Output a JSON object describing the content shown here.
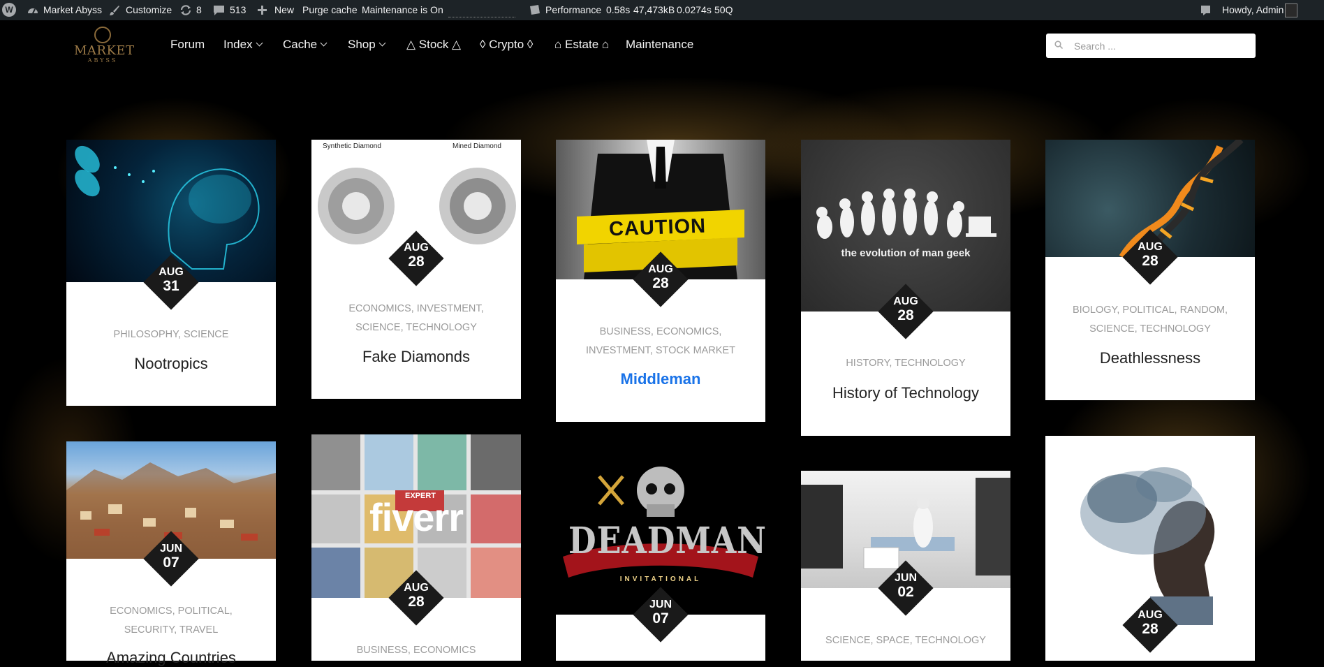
{
  "admin_bar": {
    "site_name": "Market Abyss",
    "customize": "Customize",
    "updates": "8",
    "comments": "513",
    "new": "New",
    "purge_cache": "Purge cache",
    "maintenance": "Maintenance is On",
    "performance": "Performance",
    "perf_time": "0.58s",
    "perf_memory": "47,473kB",
    "perf_db_time": "0.0274s",
    "perf_queries": "50Q",
    "greeting": "Howdy, Admin"
  },
  "logo": {
    "text": "MARKET",
    "subtext": "ABYSS"
  },
  "nav": [
    {
      "label": "Forum",
      "dropdown": false
    },
    {
      "label": "Index",
      "dropdown": true
    },
    {
      "label": "Cache",
      "dropdown": true
    },
    {
      "label": "Shop",
      "dropdown": true
    },
    {
      "label": "△ Stock △",
      "dropdown": false
    },
    {
      "label": "◊ Crypto ◊",
      "dropdown": false
    },
    {
      "label": "⌂ Estate ⌂",
      "dropdown": false
    },
    {
      "label": "Maintenance",
      "dropdown": false
    }
  ],
  "search": {
    "placeholder": "Search ..."
  },
  "posts": [
    {
      "month": "AUG",
      "day": "31",
      "cats_line1": "PHILOSOPHY, SCIENCE",
      "cats_line2": "",
      "title": "Nootropics"
    },
    {
      "month": "AUG",
      "day": "28",
      "cats_line1": "ECONOMICS, INVESTMENT,",
      "cats_line2": "SCIENCE, TECHNOLOGY",
      "title": "Fake Diamonds",
      "thumb_label_left": "Synthetic Diamond",
      "thumb_label_right": "Mined Diamond"
    },
    {
      "month": "AUG",
      "day": "28",
      "cats_line1": "BUSINESS, ECONOMICS,",
      "cats_line2": "INVESTMENT, STOCK MARKET",
      "title": "Middleman",
      "thumb_text": "CAUTION"
    },
    {
      "month": "AUG",
      "day": "28",
      "cats_line1": "HISTORY, TECHNOLOGY",
      "cats_line2": "",
      "title": "History of Technology",
      "thumb_text": "the evolution of man geek"
    },
    {
      "month": "AUG",
      "day": "28",
      "cats_line1": "BIOLOGY, POLITICAL, RANDOM,",
      "cats_line2": "SCIENCE, TECHNOLOGY",
      "title": "Deathlessness"
    },
    {
      "month": "JUN",
      "day": "07",
      "cats_line1": "ECONOMICS, POLITICAL,",
      "cats_line2": "SECURITY, TRAVEL",
      "title": "Amazing Countries"
    },
    {
      "month": "AUG",
      "day": "28",
      "cats_line1": "BUSINESS, ECONOMICS",
      "cats_line2": "",
      "title": "",
      "thumb_text": "fiverr",
      "thumb_badge": "EXPERT"
    },
    {
      "month": "JUN",
      "day": "07",
      "cats_line1": "",
      "cats_line2": "",
      "title": "",
      "thumb_text": "DEADMAN",
      "thumb_subtext": "INVITATIONAL"
    },
    {
      "month": "JUN",
      "day": "02",
      "cats_line1": "SCIENCE, SPACE, TECHNOLOGY",
      "cats_line2": "",
      "title": ""
    },
    {
      "month": "AUG",
      "day": "28",
      "cats_line1": "",
      "cats_line2": "",
      "title": ""
    }
  ],
  "colors": {
    "admin_bar_bg": "#1d2327",
    "page_bg": "#000000",
    "date_badge_bg": "#1a1a1a",
    "category_text": "#9a9a9a",
    "active_title": "#1a73e8",
    "logo_gold": "#9c7a47"
  },
  "icons": {
    "wp": "wordpress-logo-icon",
    "site": "dashboard-icon",
    "customize": "brush-icon",
    "updates": "updates-icon",
    "comments": "comment-icon",
    "new": "plus-icon",
    "performance": "database-icon",
    "notes": "notes-icon",
    "avatar": "avatar-icon",
    "search": "search-icon"
  }
}
